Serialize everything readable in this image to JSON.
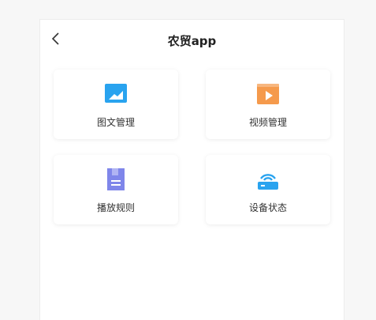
{
  "header": {
    "title": "农贸app",
    "back_icon": "chevron-left-icon"
  },
  "menu": [
    {
      "label": "图文管理",
      "icon": "image-icon",
      "color": "#29a3ef"
    },
    {
      "label": "视频管理",
      "icon": "video-icon",
      "color": "#f59a4c"
    },
    {
      "label": "播放规则",
      "icon": "document-icon",
      "color": "#7f86ea"
    },
    {
      "label": "设备状态",
      "icon": "wifi-router-icon",
      "color": "#29a3ef"
    }
  ]
}
